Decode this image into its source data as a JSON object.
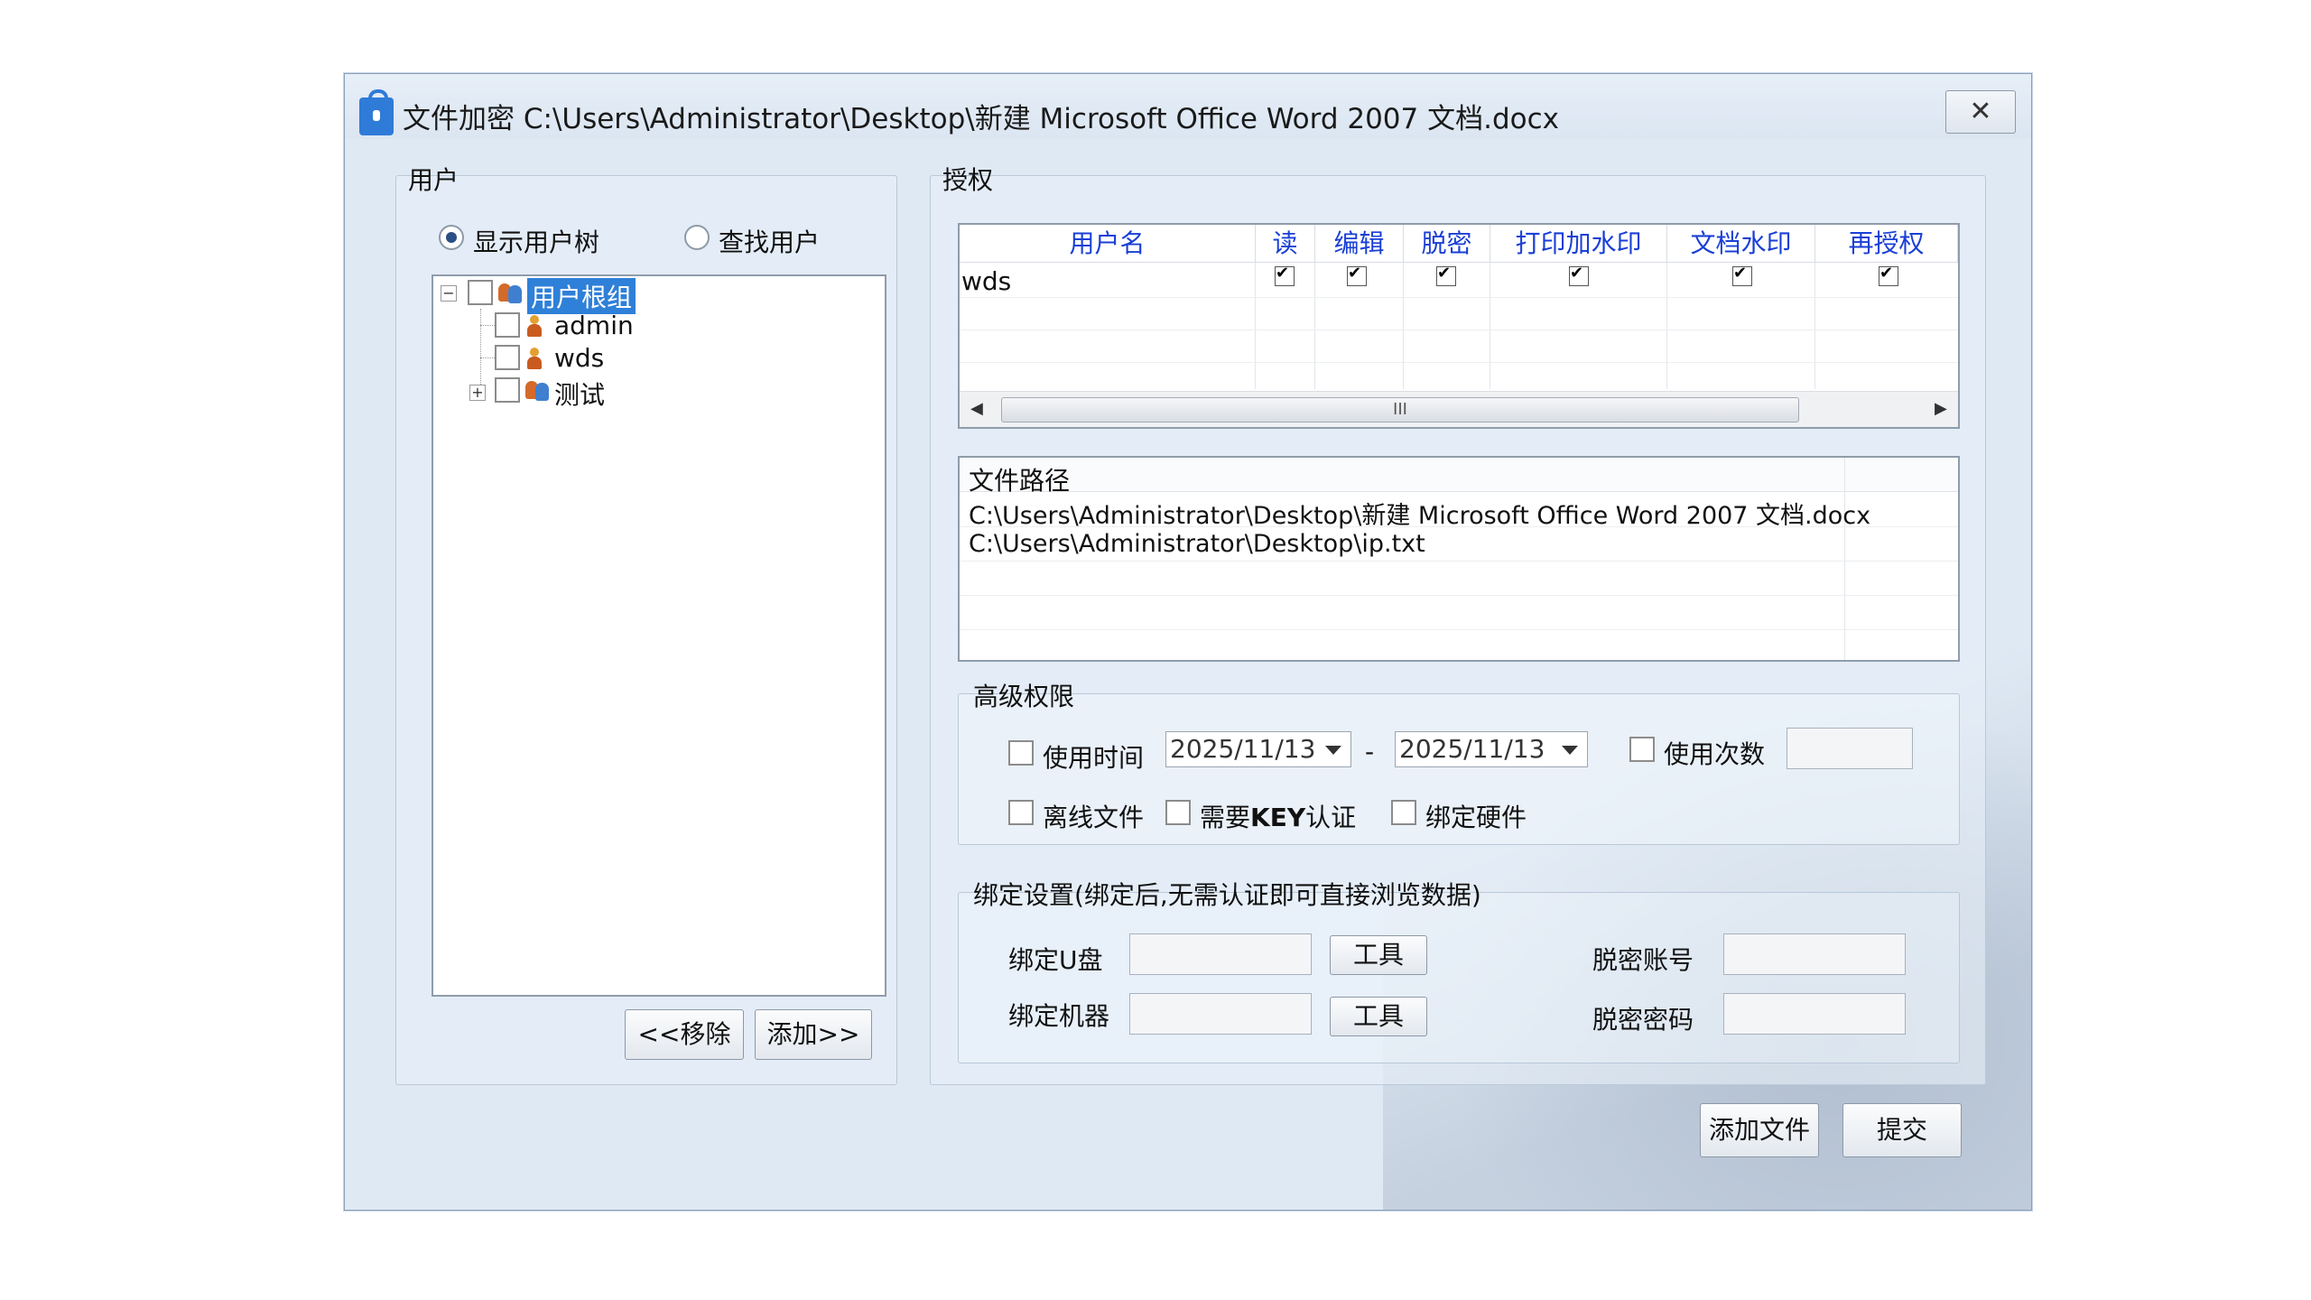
{
  "window": {
    "title": "文件加密 C:\\Users\\Administrator\\Desktop\\新建 Microsoft Office Word 2007 文档.docx",
    "close_symbol": "✕"
  },
  "users_panel": {
    "title": "用户",
    "radio_tree": "显示用户树",
    "radio_search": "查找用户",
    "selected_radio": "显示用户树",
    "tree": {
      "root": "用户根组",
      "children": [
        "admin",
        "wds",
        "测试"
      ]
    },
    "remove_button": "<<移除",
    "add_button": "添加>>"
  },
  "auth_panel": {
    "title": "授权",
    "columns": [
      "用户名",
      "读",
      "编辑",
      "脱密",
      "打印加水印",
      "文档水印",
      "再授权"
    ],
    "rows": [
      {
        "user": "wds",
        "read": true,
        "edit": true,
        "declassify": true,
        "print_watermark": true,
        "doc_watermark": true,
        "reauthorize": true
      }
    ],
    "scroll_thumb_glyph": "III",
    "scroll_left": "◀",
    "scroll_right": "▶"
  },
  "files": {
    "header": "文件路径",
    "items": [
      "C:\\Users\\Administrator\\Desktop\\新建 Microsoft Office Word 2007 文档.docx",
      "C:\\Users\\Administrator\\Desktop\\ip.txt"
    ]
  },
  "advanced": {
    "title": "高级权限",
    "use_time_label": "使用时间",
    "date_from": "2025/11/13",
    "date_sep": "-",
    "date_to": "2025/11/13",
    "use_count_label": "使用次数",
    "use_count_value": "",
    "offline_label": "离线文件",
    "key_label_prefix": "需要",
    "key_label_bold": "KEY",
    "key_label_suffix": "认证",
    "bind_hw_label": "绑定硬件"
  },
  "binding": {
    "title": "绑定设置(绑定后,无需认证即可直接浏览数据)",
    "usb_label": "绑定U盘",
    "machine_label": "绑定机器",
    "tool_button": "工具",
    "account_label": "脱密账号",
    "password_label": "脱密密码"
  },
  "footer": {
    "add_file_button": "添加文件",
    "submit_button": "提交"
  },
  "colors": {
    "header_text": "#1a3fd6",
    "selection": "#2f80d8",
    "window_bg": "#dfe9f4"
  }
}
